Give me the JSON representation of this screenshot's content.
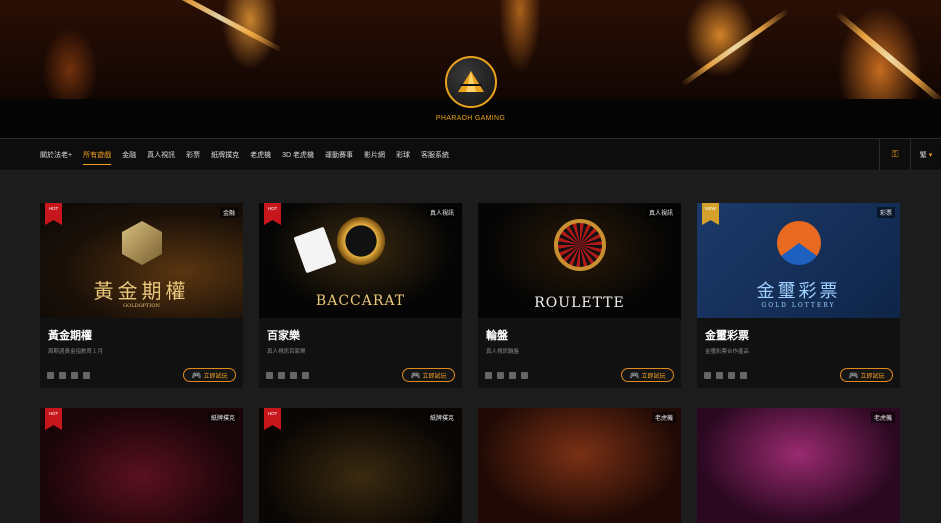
{
  "brand": {
    "name": "PHARAOH GAMING",
    "accent": "#e8a21d"
  },
  "nav": {
    "items": [
      "關於法老+",
      "所有遊戲",
      "金融",
      "真人視訊",
      "彩票",
      "紙牌撲克",
      "老虎機",
      "3D 老虎機",
      "運動賽事",
      "影片網",
      "彩球",
      "客服系統"
    ],
    "active_index": 1,
    "right": {
      "lang": "繁"
    }
  },
  "cards": [
    {
      "title": "黃金期權",
      "sub": "周期週黃金指數買１月",
      "category": "金融",
      "badge": "HOT",
      "art_text": "黃金期權",
      "art_sub": "GOLDOPTION",
      "play": "立即試玩"
    },
    {
      "title": "百家樂",
      "sub": "真人視訊百家樂",
      "category": "真人視訊",
      "badge": "HOT",
      "art_text": "BACCARAT",
      "play": "立即試玩"
    },
    {
      "title": "輪盤",
      "sub": "真人視訊輪盤",
      "category": "真人視訊",
      "badge": "",
      "art_text": "ROULETTE",
      "play": "立即試玩"
    },
    {
      "title": "金璽彩票",
      "sub": "金璽彩票合作產品",
      "category": "彩票",
      "badge": "NEW",
      "art_text": "金璽彩票",
      "art_sub": "GOLD LOTTERY",
      "play": "立即試玩"
    }
  ],
  "row2_categories": [
    "紙牌撲克",
    "紙牌撲克",
    "老虎機",
    "老虎機"
  ],
  "row2_badges": [
    "HOT",
    "HOT",
    "",
    ""
  ]
}
